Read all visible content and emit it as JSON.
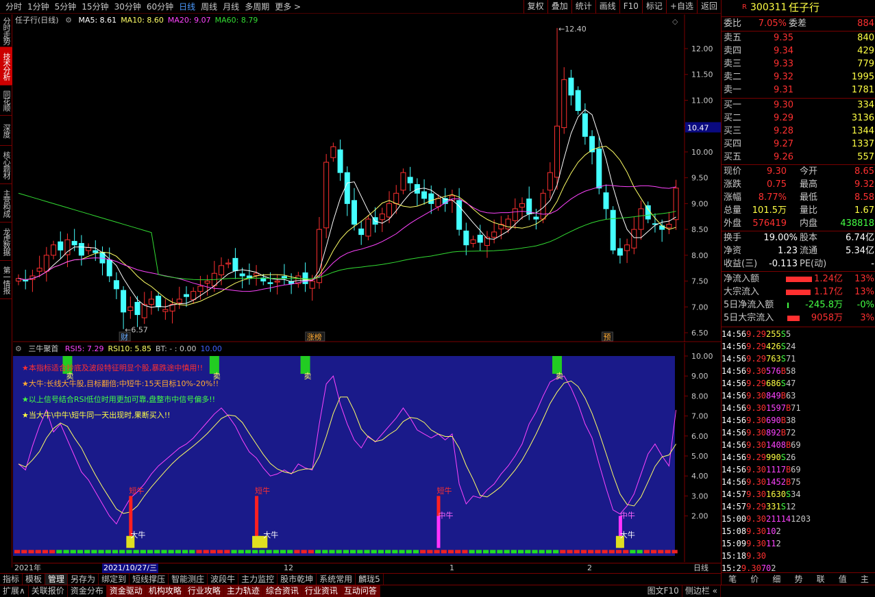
{
  "periods": [
    "分时",
    "1分钟",
    "5分钟",
    "15分钟",
    "30分钟",
    "60分钟",
    "日线",
    "周线",
    "月线",
    "多周期",
    "更多 >"
  ],
  "active_period": "日线",
  "right_buttons": [
    "复权",
    "叠加",
    "统计",
    "画线",
    "F10",
    "标记",
    "+自选",
    "返回"
  ],
  "left_tabs": [
    {
      "label": "分时走势",
      "active": false
    },
    {
      "label": "技术分析",
      "active": true
    },
    {
      "label": "同花顺",
      "active": false
    },
    {
      "label": "深度F9",
      "active": false
    },
    {
      "label": "核心题材",
      "active": false
    },
    {
      "label": "主营构成",
      "active": false
    },
    {
      "label": "龙虎数据",
      "active": false
    },
    {
      "label": "第一情报",
      "active": false
    }
  ],
  "main": {
    "title": "任子行(日线)",
    "ma": [
      {
        "label": "MA5: 8.61",
        "color": "#ffffff"
      },
      {
        "label": "MA10: 8.60",
        "color": "#ffff66"
      },
      {
        "label": "MA20: 9.07",
        "color": "#ff44ff"
      },
      {
        "label": "MA60: 8.79",
        "color": "#33dd33"
      }
    ],
    "yticks": [
      "12.00",
      "11.50",
      "11.00",
      "10.50",
      "10.00",
      "9.50",
      "9.00",
      "8.50",
      "8.00",
      "7.50",
      "7.00",
      "6.50"
    ],
    "current_price_tag": "10.47",
    "high_label": "12.40",
    "low_label": "6.57",
    "event_tags": [
      "财",
      "涨榜",
      "预"
    ]
  },
  "indicator": {
    "title": "三牛聚首",
    "legend": [
      {
        "label": "RSI5: 7.29",
        "color": "#ff44ff"
      },
      {
        "label": "RSI10: 5.85",
        "color": "#ffff66"
      },
      {
        "label": "BT: - : 0.00",
        "color": "#c8c8c8"
      },
      {
        "label": "10.00",
        "color": "#4060ff"
      }
    ],
    "yticks": [
      "10.00",
      "9.00",
      "8.00",
      "7.00",
      "6.00",
      "5.00",
      "4.00",
      "3.00",
      "2.00"
    ],
    "notes": [
      {
        "text": "★本指标适合抄底及波段特征明显个股,暴跌途中慎用!!",
        "color": "#ff3030"
      },
      {
        "text": "★大牛:长线大牛股,目标翻倍;中短牛:15天目标10%-20%!!",
        "color": "#ffaa33"
      },
      {
        "text": "★以上信号结合RSI低位时用更加可靠,盘整市中信号偏多!!",
        "color": "#44ff44"
      },
      {
        "text": "★当大牛\\中牛\\短牛同一天出现时,果断买入!!",
        "color": "#ffff44"
      }
    ],
    "signal_sell": "卖",
    "signal_short": "短牛",
    "signal_mid": "中牛",
    "signal_big": "大牛"
  },
  "datebar": {
    "labels": [
      "2021年",
      "2021/10/27/三",
      "12",
      "1",
      "2"
    ],
    "right": "日线"
  },
  "tabs1": [
    "指标",
    "模板",
    "管理",
    "另存为",
    "绑定到",
    "短线撑压",
    "智能测庄",
    "波段牛",
    "主力监控",
    "股市乾坤",
    "系统常用",
    "麟珑5"
  ],
  "tabs1_active": "管理",
  "tabs2": [
    "扩展∧",
    "关联报价",
    "资金分布",
    "资金驱动",
    "机构攻略",
    "行业攻略",
    "主力轨迹",
    "综合资讯",
    "行业资讯",
    "互动问答"
  ],
  "tabs2_hl": [
    "资金驱动",
    "机构攻略",
    "行业攻略",
    "主力轨迹",
    "综合资讯",
    "行业资讯",
    "互动问答"
  ],
  "tabs2_right": [
    "图文F10",
    "侧边栏 «"
  ],
  "stock": {
    "flag": "R",
    "code": "300311",
    "name": "任子行"
  },
  "weibi": {
    "l1": "委比",
    "v1": "7.05%",
    "l2": "委差",
    "v2": "884"
  },
  "asks": [
    {
      "label": "卖五",
      "price": "9.35",
      "vol": "840"
    },
    {
      "label": "卖四",
      "price": "9.34",
      "vol": "429"
    },
    {
      "label": "卖三",
      "price": "9.33",
      "vol": "779"
    },
    {
      "label": "卖二",
      "price": "9.32",
      "vol": "1995"
    },
    {
      "label": "卖一",
      "price": "9.31",
      "vol": "1781"
    }
  ],
  "bids": [
    {
      "label": "买一",
      "price": "9.30",
      "vol": "334"
    },
    {
      "label": "买二",
      "price": "9.29",
      "vol": "3136"
    },
    {
      "label": "买三",
      "price": "9.28",
      "vol": "1344"
    },
    {
      "label": "买四",
      "price": "9.27",
      "vol": "1337"
    },
    {
      "label": "买五",
      "price": "9.26",
      "vol": "557"
    }
  ],
  "quote": [
    {
      "l1": "现价",
      "v1": "9.30",
      "c1": "#ff3030",
      "l2": "今开",
      "v2": "8.65",
      "c2": "#ff3030"
    },
    {
      "l1": "涨跌",
      "v1": "0.75",
      "c1": "#ff3030",
      "l2": "最高",
      "v2": "9.32",
      "c2": "#ff3030"
    },
    {
      "l1": "涨幅",
      "v1": "8.77%",
      "c1": "#ff3030",
      "l2": "最低",
      "v2": "8.58",
      "c2": "#ff3030"
    },
    {
      "l1": "总量",
      "v1": "101.5万",
      "c1": "#ffff44",
      "l2": "量比",
      "v2": "1.67",
      "c2": "#ffff44"
    },
    {
      "l1": "外盘",
      "v1": "576419",
      "c1": "#ff3030",
      "l2": "内盘",
      "v2": "438818",
      "c2": "#44ff44"
    }
  ],
  "stats": [
    {
      "l1": "换手",
      "v1": "19.00%",
      "l2": "股本",
      "v2": "6.74亿"
    },
    {
      "l1": "净资",
      "v1": "1.23",
      "l2": "流通",
      "v2": "5.34亿"
    },
    {
      "l1": "收益(三)",
      "v1": "-0.113",
      "l2": "PE(动)",
      "v2": "-"
    }
  ],
  "flows": [
    {
      "label": "净流入额",
      "val": "1.24亿",
      "pct": "13%",
      "bar": 38,
      "color": "#ff3030"
    },
    {
      "label": "大宗流入",
      "val": "1.17亿",
      "pct": "13%",
      "bar": 36,
      "color": "#ff3030"
    },
    {
      "label": "5日净流入额",
      "val": "-245.8万",
      "pct": "-0%",
      "bar": 2,
      "color": "#44ff44"
    },
    {
      "label": "5日大宗流入",
      "val": "9058万",
      "pct": "3%",
      "bar": 18,
      "color": "#ff3030"
    }
  ],
  "ticks": [
    {
      "t": "14:56",
      "p": "9.29",
      "v": "255",
      "bs": "S",
      "n": "5"
    },
    {
      "t": "14:56",
      "p": "9.29",
      "v": "426",
      "bs": "S",
      "n": "24"
    },
    {
      "t": "14:56",
      "p": "9.29",
      "v": "763",
      "bs": "S",
      "n": "71"
    },
    {
      "t": "14:56",
      "p": "9.30",
      "v": "576",
      "bs": "B",
      "n": "58"
    },
    {
      "t": "14:56",
      "p": "9.29",
      "v": "686",
      "bs": "S",
      "n": "47"
    },
    {
      "t": "14:56",
      "p": "9.30",
      "v": "849",
      "bs": "B",
      "n": "63"
    },
    {
      "t": "14:56",
      "p": "9.30",
      "v": "1597",
      "bs": "B",
      "n": "71"
    },
    {
      "t": "14:56",
      "p": "9.30",
      "v": "690",
      "bs": "B",
      "n": "38"
    },
    {
      "t": "14:56",
      "p": "9.30",
      "v": "892",
      "bs": "B",
      "n": "72"
    },
    {
      "t": "14:56",
      "p": "9.30",
      "v": "1408",
      "bs": "B",
      "n": "69"
    },
    {
      "t": "14:56",
      "p": "9.29",
      "v": "990",
      "bs": "S",
      "n": "26"
    },
    {
      "t": "14:56",
      "p": "9.30",
      "v": "1117",
      "bs": "B",
      "n": "69"
    },
    {
      "t": "14:56",
      "p": "9.30",
      "v": "1452",
      "bs": "B",
      "n": "75"
    },
    {
      "t": "14:57",
      "p": "9.30",
      "v": "1630",
      "bs": "S",
      "n": "34"
    },
    {
      "t": "14:57",
      "p": "9.29",
      "v": "331",
      "bs": "S",
      "n": "12"
    },
    {
      "t": "15:00",
      "p": "9.30",
      "v": "21114",
      "bs": "",
      "n": "1203"
    },
    {
      "t": "15:08",
      "p": "9.30",
      "v": "10",
      "bs": "",
      "n": "2"
    },
    {
      "t": "15:09",
      "p": "9.30",
      "v": "11",
      "bs": "",
      "n": "2"
    },
    {
      "t": "15:18",
      "p": "9.30",
      "v": "",
      "bs": "",
      "n": ""
    },
    {
      "t": "15:2",
      "p": "9.30",
      "v": "70",
      "bs": "",
      "n": "2"
    }
  ],
  "ticks_footer": [
    "笔",
    "价",
    "细",
    "势",
    "联",
    "值",
    "主"
  ],
  "colors": {
    "up": "#ff3030",
    "down": "#44ffff",
    "bg_ind": "#1a1a8a",
    "ma5": "#ffffff",
    "ma10": "#ffff66",
    "ma20": "#ff44ff",
    "ma60": "#33dd33"
  }
}
